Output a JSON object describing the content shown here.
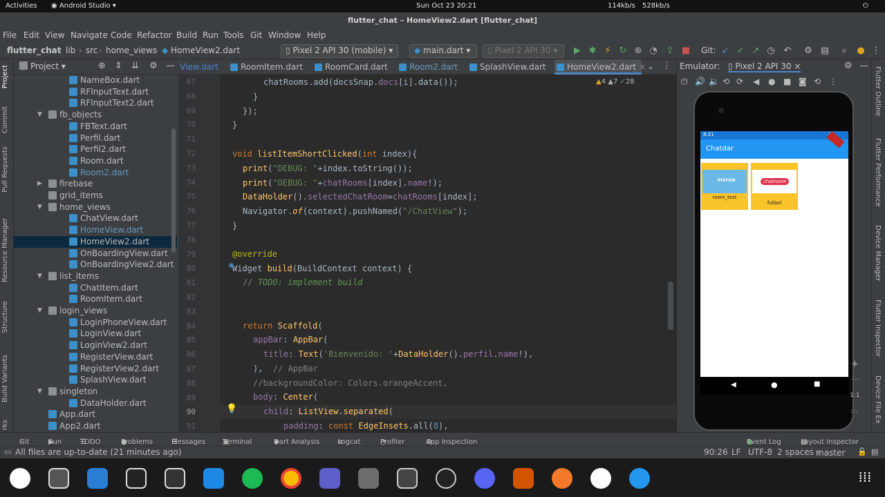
{
  "gnome": {
    "activities": "Activities",
    "app": "Android Studio",
    "clock": "Sun Oct 23  20:21",
    "net_down": "114kb/s",
    "net_up": "528kb/s"
  },
  "window_title": "flutter_chat – HomeView2.dart [flutter_chat]",
  "menu": [
    "File",
    "Edit",
    "View",
    "Navigate",
    "Code",
    "Refactor",
    "Build",
    "Run",
    "Tools",
    "Git",
    "Window",
    "Help"
  ],
  "breadcrumb": [
    "flutter_chat",
    "lib",
    "src",
    "home_views",
    "HomeView2.dart"
  ],
  "toolbar": {
    "device": "Pixel 2 API 30 (mobile)",
    "run_config": "main.dart",
    "target": "Pixel 2 API 30",
    "git_label": "Git:"
  },
  "project_panel": {
    "title": "Project"
  },
  "tree": [
    {
      "label": "NameBox.dart",
      "type": "file",
      "depth": 3
    },
    {
      "label": "RFInputText.dart",
      "type": "file",
      "depth": 3
    },
    {
      "label": "RFInputText2.dart",
      "type": "file",
      "depth": 3
    },
    {
      "label": "fb_objects",
      "type": "folder",
      "depth": 2,
      "open": true
    },
    {
      "label": "FBText.dart",
      "type": "file",
      "depth": 3
    },
    {
      "label": "Perfil.dart",
      "type": "file",
      "depth": 3
    },
    {
      "label": "Perfil2.dart",
      "type": "file",
      "depth": 3
    },
    {
      "label": "Room.dart",
      "type": "file",
      "depth": 3
    },
    {
      "label": "Room2.dart",
      "type": "file",
      "depth": 3,
      "modified": true
    },
    {
      "label": "firebase",
      "type": "folder",
      "depth": 2,
      "open": false
    },
    {
      "label": "grid_items",
      "type": "folder",
      "depth": 2,
      "noarrow": true
    },
    {
      "label": "home_views",
      "type": "folder",
      "depth": 2,
      "open": true
    },
    {
      "label": "ChatView.dart",
      "type": "file",
      "depth": 3
    },
    {
      "label": "HomeView.dart",
      "type": "file",
      "depth": 3,
      "modified": true
    },
    {
      "label": "HomeView2.dart",
      "type": "file",
      "depth": 3,
      "selected": true
    },
    {
      "label": "OnBoardingView.dart",
      "type": "file",
      "depth": 3
    },
    {
      "label": "OnBoardingView2.dart",
      "type": "file",
      "depth": 3
    },
    {
      "label": "list_items",
      "type": "folder",
      "depth": 2,
      "open": true
    },
    {
      "label": "ChatItem.dart",
      "type": "file",
      "depth": 3
    },
    {
      "label": "RoomItem.dart",
      "type": "file",
      "depth": 3
    },
    {
      "label": "login_views",
      "type": "folder",
      "depth": 2,
      "open": true
    },
    {
      "label": "LoginPhoneView.dart",
      "type": "file",
      "depth": 3
    },
    {
      "label": "LoginView.dart",
      "type": "file",
      "depth": 3
    },
    {
      "label": "LoginView2.dart",
      "type": "file",
      "depth": 3
    },
    {
      "label": "RegisterView.dart",
      "type": "file",
      "depth": 3
    },
    {
      "label": "RegisterView2.dart",
      "type": "file",
      "depth": 3
    },
    {
      "label": "SplashView.dart",
      "type": "file",
      "depth": 3
    },
    {
      "label": "singleton",
      "type": "folder",
      "depth": 2,
      "open": true
    },
    {
      "label": "DataHolder.dart",
      "type": "file",
      "depth": 3
    },
    {
      "label": "App.dart",
      "type": "file",
      "depth": 2
    },
    {
      "label": "App2.dart",
      "type": "file",
      "depth": 2
    }
  ],
  "left_strip": [
    "Project",
    "Commit",
    "Pull Requests",
    "Resource Manager",
    "Structure",
    "Build Variants",
    "rks"
  ],
  "right_strip": [
    "Flutter Outline",
    "Flutter Performance",
    "Device Manager",
    "Flutter Inspector",
    "Device File Ex"
  ],
  "tabs": [
    "View.dart",
    "RoomItem.dart",
    "RoomCard.dart",
    "Room2.dart",
    "SplashView.dart",
    "HomeView2.dart"
  ],
  "inspections": {
    "warnings": "4",
    "weak": "7",
    "typos": "28"
  },
  "line_numbers": [
    "67",
    "68",
    "69",
    "70",
    "71",
    "72",
    "73",
    "74",
    "75",
    "76",
    "77",
    "78",
    "79",
    "80",
    "81",
    "82",
    "83",
    "84",
    "85",
    "86",
    "87",
    "88",
    "89",
    "90",
    "91"
  ],
  "emulator": {
    "label": "Emulator:",
    "device": "Pixel 2 API 30",
    "time": "8:21",
    "app_title": "Chatdar",
    "cards": [
      {
        "name": "room_test",
        "img": "PIXTON"
      },
      {
        "name": "futbol",
        "img": "chatroom"
      }
    ],
    "zoom": "1:1"
  },
  "bottom_tools": [
    "Git",
    "Run",
    "TODO",
    "Problems",
    "Messages",
    "Terminal",
    "Dart Analysis",
    "Logcat",
    "Profiler",
    "App Inspection",
    "Event Log",
    "Layout Inspector"
  ],
  "status": {
    "message": "All files are up-to-date (21 minutes ago)",
    "position": "90:26",
    "line_sep": "LF",
    "encoding": "UTF-8",
    "indent": "2 spaces",
    "branch": "master"
  },
  "colors": {
    "accent": "#2196f3",
    "card": "#f9c32a",
    "selection": "#0d293e"
  }
}
